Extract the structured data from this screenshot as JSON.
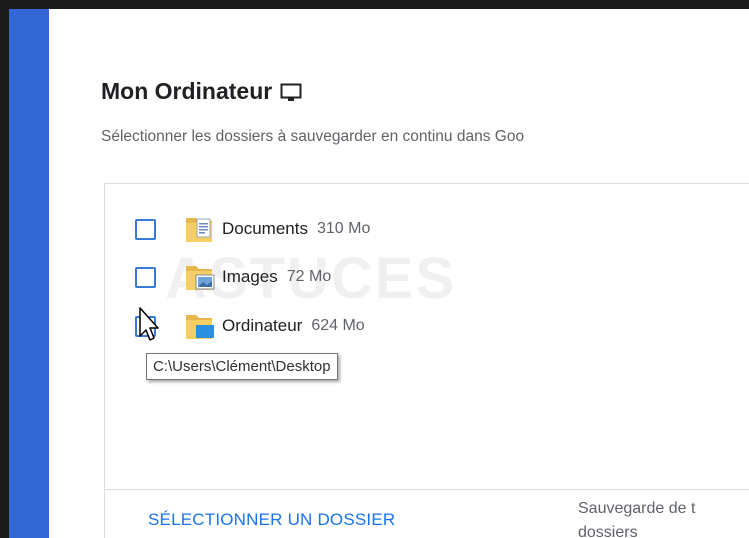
{
  "header": {
    "title": "Mon Ordinateur",
    "subtitle": "Sélectionner les dossiers à sauvegarder en continu dans Goo"
  },
  "folders": [
    {
      "name": "Documents",
      "size": "310 Mo",
      "checked": false,
      "icon": "documents-folder-icon"
    },
    {
      "name": "Images",
      "size": "72 Mo",
      "checked": false,
      "icon": "images-folder-icon"
    },
    {
      "name": "Ordinateur",
      "size": "624 Mo",
      "checked": false,
      "icon": "desktop-folder-icon"
    }
  ],
  "tooltip": "C:\\Users\\Clément\\Desktop",
  "footer": {
    "select_folder_label": "SÉLECTIONNER UN DOSSIER",
    "info_line1": "Sauvegarde de t",
    "info_line2": "dossiers"
  },
  "colors": {
    "accent_bar": "#3367d6",
    "link": "#1a73e8",
    "checkbox": "#3c78d8"
  }
}
